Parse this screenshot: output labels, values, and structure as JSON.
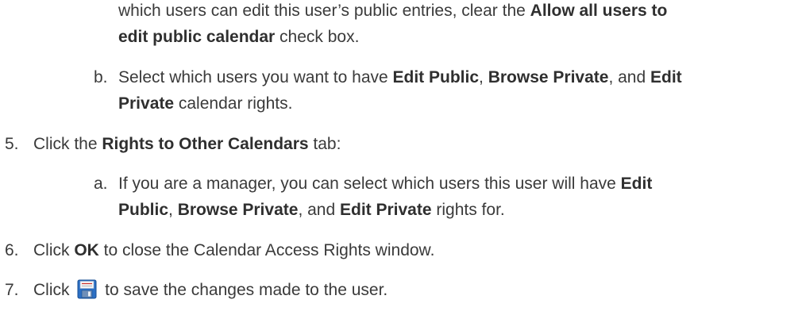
{
  "doc": {
    "l1": {
      "t1": "which users can edit this user’s public entries, clear the ",
      "b1": "Allow all users to"
    },
    "l2": {
      "b1": "edit public calendar",
      "t1": " check box."
    },
    "b_item": {
      "marker": "b.",
      "t1": "Select which users you want to have ",
      "b1": "Edit Public",
      "t2": ", ",
      "b2": "Browse Private",
      "t3": ", and ",
      "b3": "Edit"
    },
    "l4": {
      "b1": "Private",
      "t1": " calendar rights."
    },
    "step5": {
      "marker": "5.",
      "t1": "Click the ",
      "b1": "Rights to Other Calendars",
      "t2": " tab:"
    },
    "a_item": {
      "marker": "a.",
      "t1": "If you are a manager, you can select which users this user will have ",
      "b1": "Edit"
    },
    "l7": {
      "b1": "Public",
      "t1": ", ",
      "b2": "Browse Private",
      "t2": ", and ",
      "b3": "Edit Private",
      "t3": " rights for."
    },
    "step6": {
      "marker": "6.",
      "t1": "Click ",
      "b1": "OK",
      "t2": " to close the Calendar Access Rights window."
    },
    "step7": {
      "marker": "7.",
      "t1": "Click ",
      "icon": "save-icon",
      "t2": " to save the changes made to the user."
    }
  }
}
